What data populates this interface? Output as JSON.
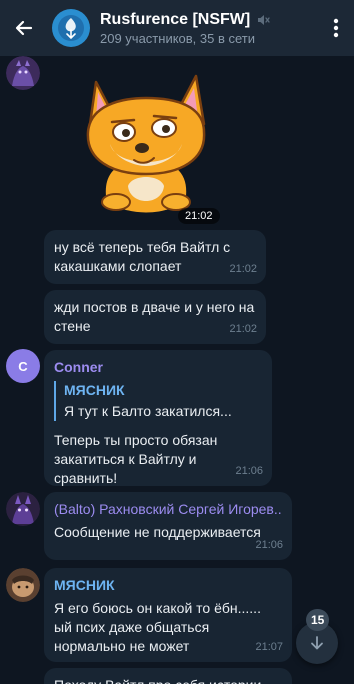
{
  "header": {
    "title": "Rusfurence [NSFW]",
    "subtitle": "209 участников, 35 в сети",
    "muted_icon": "speaker-muted-icon",
    "back_icon": "arrow-left-icon",
    "menu_icon": "vertical-dots-icon"
  },
  "messages": [
    {
      "type": "sticker",
      "time": "21:02",
      "sticker": "orange-fox-sticker"
    },
    {
      "type": "text",
      "text": "ну всё теперь тебя Вайтл с какашками слопает",
      "time": "21:02"
    },
    {
      "type": "text",
      "text": "жди постов в дваче и у него на стене",
      "time": "21:02"
    },
    {
      "type": "reply",
      "sender": "Conner",
      "sender_color": "#9c8cf0",
      "avatar_letter": "C",
      "reply_author": "МЯСНИК",
      "reply_text": "Я тут к Балто закатился...",
      "text": "Теперь ты просто обязан закатиться к Вайтлу и сравнить!",
      "time": "21:06"
    },
    {
      "type": "text",
      "sender": "(Balto) Рахновский Сергей Игорев...",
      "sender_color": "#9c8cf0",
      "text": "Сообщение не поддерживается",
      "time": "21:06"
    },
    {
      "type": "text",
      "sender": "МЯСНИК",
      "sender_color": "#6eb4f2",
      "text": "Я его боюсь он какой то ёбн...... ый псих даже общаться нормально не может",
      "time": "21:07"
    },
    {
      "type": "text",
      "text": "Походу Вайтл про себя истории"
    }
  ],
  "scroll_button": {
    "unread_count": "15",
    "icon": "chevron-down-icon"
  },
  "colors": {
    "background": "#0e1621",
    "header": "#1c2836",
    "bubble": "#182533",
    "accent": "#6eb4f2"
  }
}
